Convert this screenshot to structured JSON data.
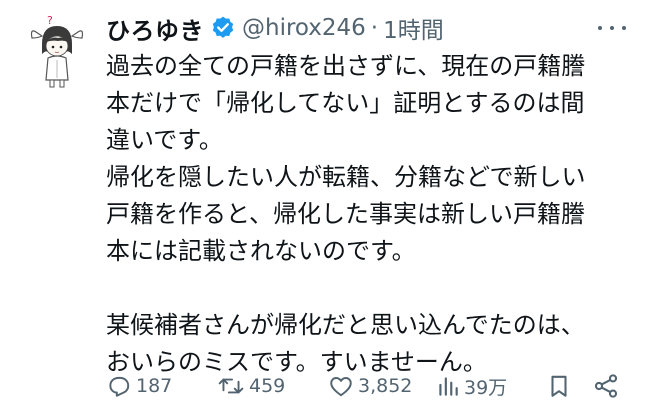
{
  "tweet": {
    "display_name": "ひろゆき",
    "handle": "@hirox246",
    "separator": "·",
    "time": "1時間",
    "lines": [
      "過去の全ての戸籍を出さずに、現在の戸籍謄",
      "本だけで「帰化してない」証明とするのは間",
      "違いです。",
      "帰化を隠したい人が転籍、分籍などで新しい",
      "戸籍を作ると、帰化した事実は新しい戸籍謄",
      "本には記載されないのです。",
      "",
      "某候補者さんが帰化だと思い込んでたのは、",
      "おいらのミスです。すいませーん。"
    ]
  },
  "actions": {
    "replies": "187",
    "retweets": "459",
    "likes": "3,852",
    "views": "39万"
  },
  "icons": {
    "verified": "verified-badge-icon",
    "reply": "reply-icon",
    "retweet": "retweet-icon",
    "like": "heart-icon",
    "views": "views-chart-icon",
    "bookmark": "bookmark-icon",
    "share": "share-icon",
    "more": "more-options-icon"
  },
  "colors": {
    "text": "#0f1419",
    "secondary": "#536471",
    "verified": "#1d9bf0",
    "avatar_accent": "#e0245e"
  }
}
